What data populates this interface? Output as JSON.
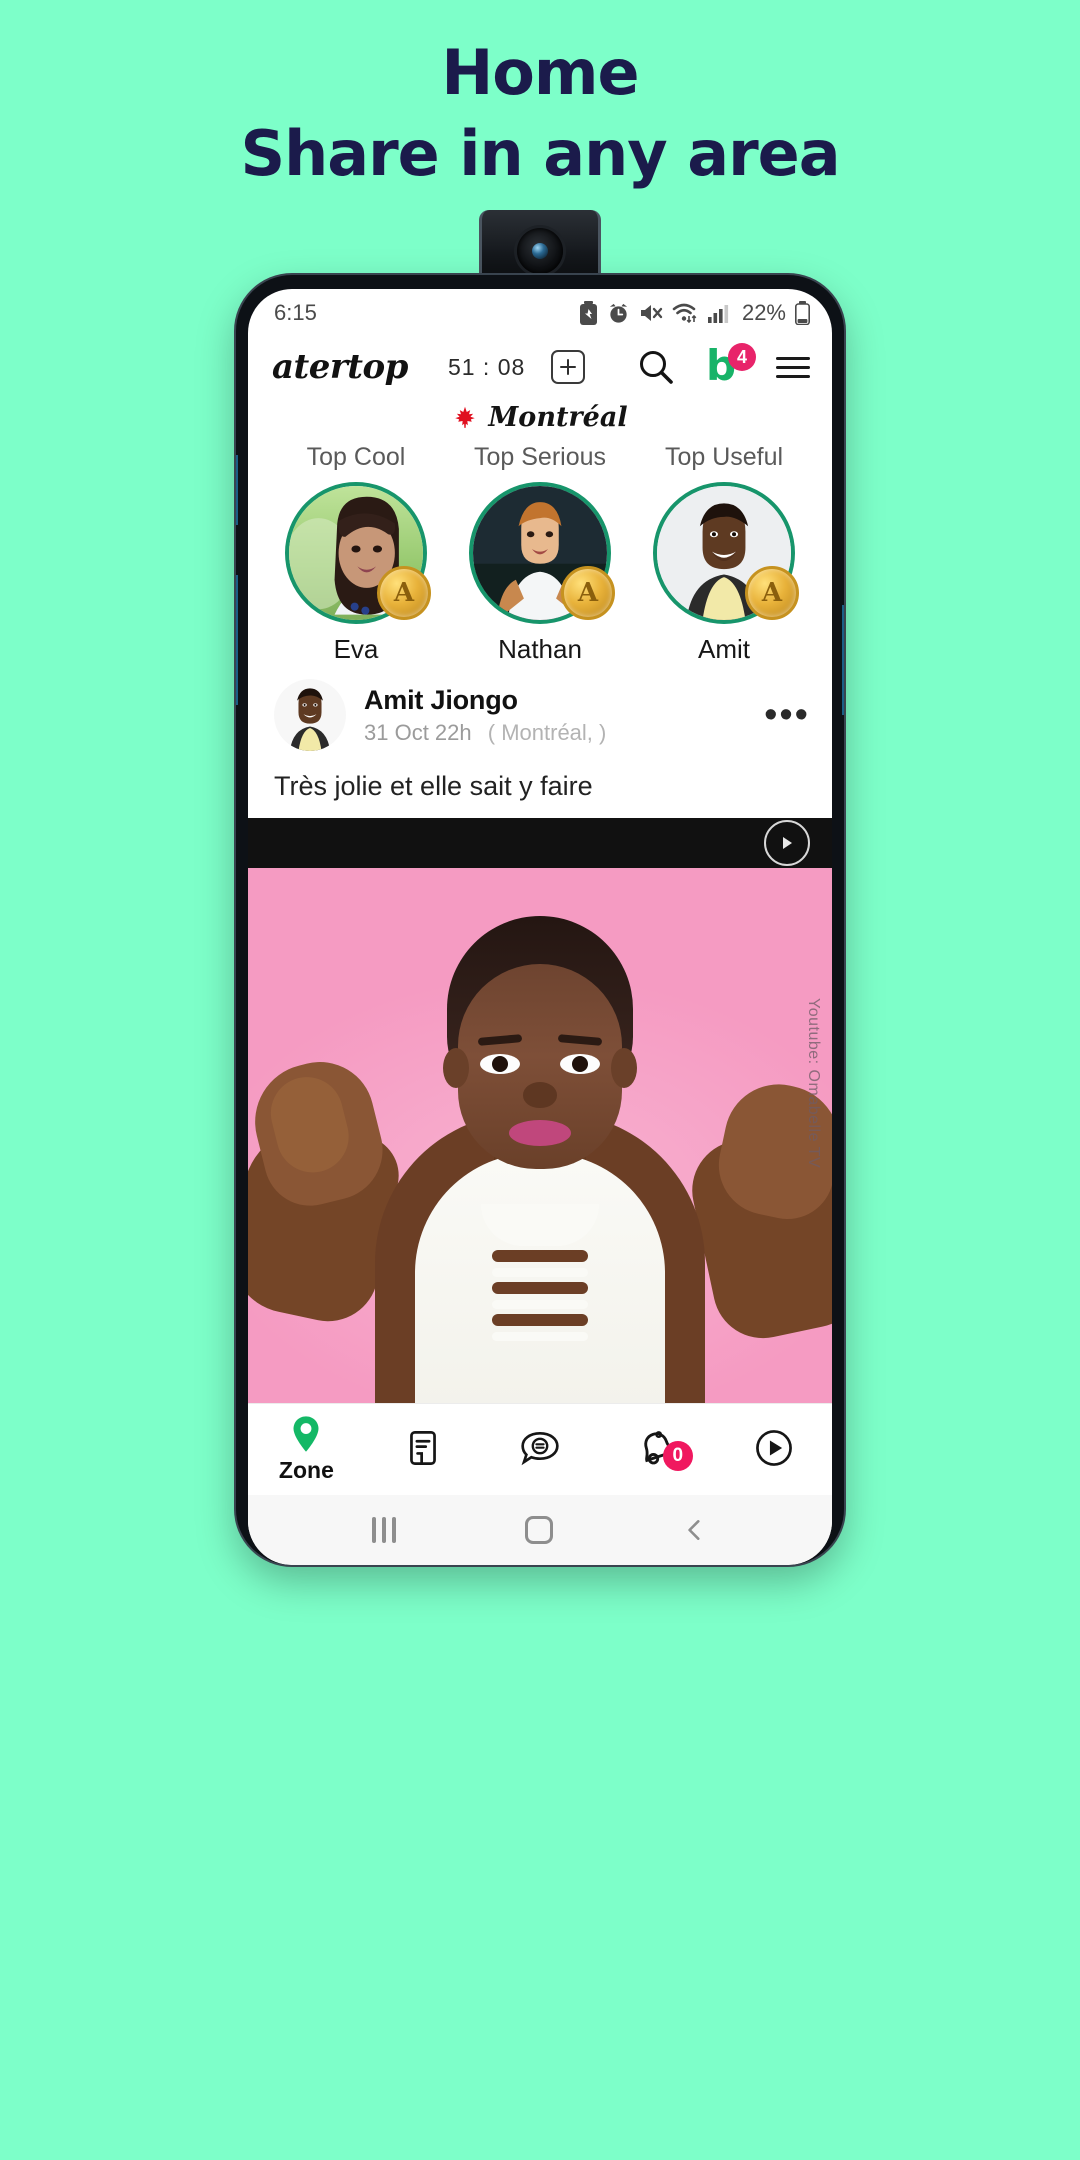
{
  "promo": {
    "line1": "Home",
    "line2": "Share in any area",
    "bg_color": "#7DFFC9",
    "text_color": "#1B1B4B"
  },
  "statusbar": {
    "time": "6:15",
    "battery_percent": "22%",
    "icons": [
      "battery-saver-icon",
      "alarm-icon",
      "mute-icon",
      "wifi-icon",
      "signal-icon",
      "battery-icon"
    ]
  },
  "appbar": {
    "brand": "atertop",
    "timer": "51 : 08",
    "add_label": "+",
    "search_icon": "search-icon",
    "notifications_logo": "b",
    "notifications_count": "4",
    "menu_icon": "hamburger-menu-icon",
    "accent_green": "#18B368",
    "badge_pink": "#E8246A"
  },
  "location": {
    "flag": "canada-flag-icon",
    "name": "Montréal"
  },
  "tops": [
    {
      "label": "Top Cool",
      "name": "Eva",
      "medal": "A"
    },
    {
      "label": "Top Serious",
      "name": "Nathan",
      "medal": "A"
    },
    {
      "label": "Top Useful",
      "name": "Amit",
      "medal": "A"
    }
  ],
  "post": {
    "author": "Amit Jiongo",
    "timestamp": "31 Oct 22h",
    "place": "( Montréal, )",
    "more_label": "•••",
    "text": "Très jolie et elle sait y faire",
    "media_watermark": "Youtube: Omabelle TV",
    "media_play_icon": "play-icon"
  },
  "bottomnav": [
    {
      "icon": "location-pin-icon",
      "label": "Zone",
      "badge": ""
    },
    {
      "icon": "document-icon",
      "label": "",
      "badge": ""
    },
    {
      "icon": "chat-bubble-icon",
      "label": "",
      "badge": ""
    },
    {
      "icon": "bell-icon",
      "label": "",
      "badge": "0"
    },
    {
      "icon": "play-circle-icon",
      "label": "",
      "badge": ""
    }
  ],
  "androidnav": {
    "recents": "recents-icon",
    "home": "home-icon",
    "back": "back-icon"
  }
}
